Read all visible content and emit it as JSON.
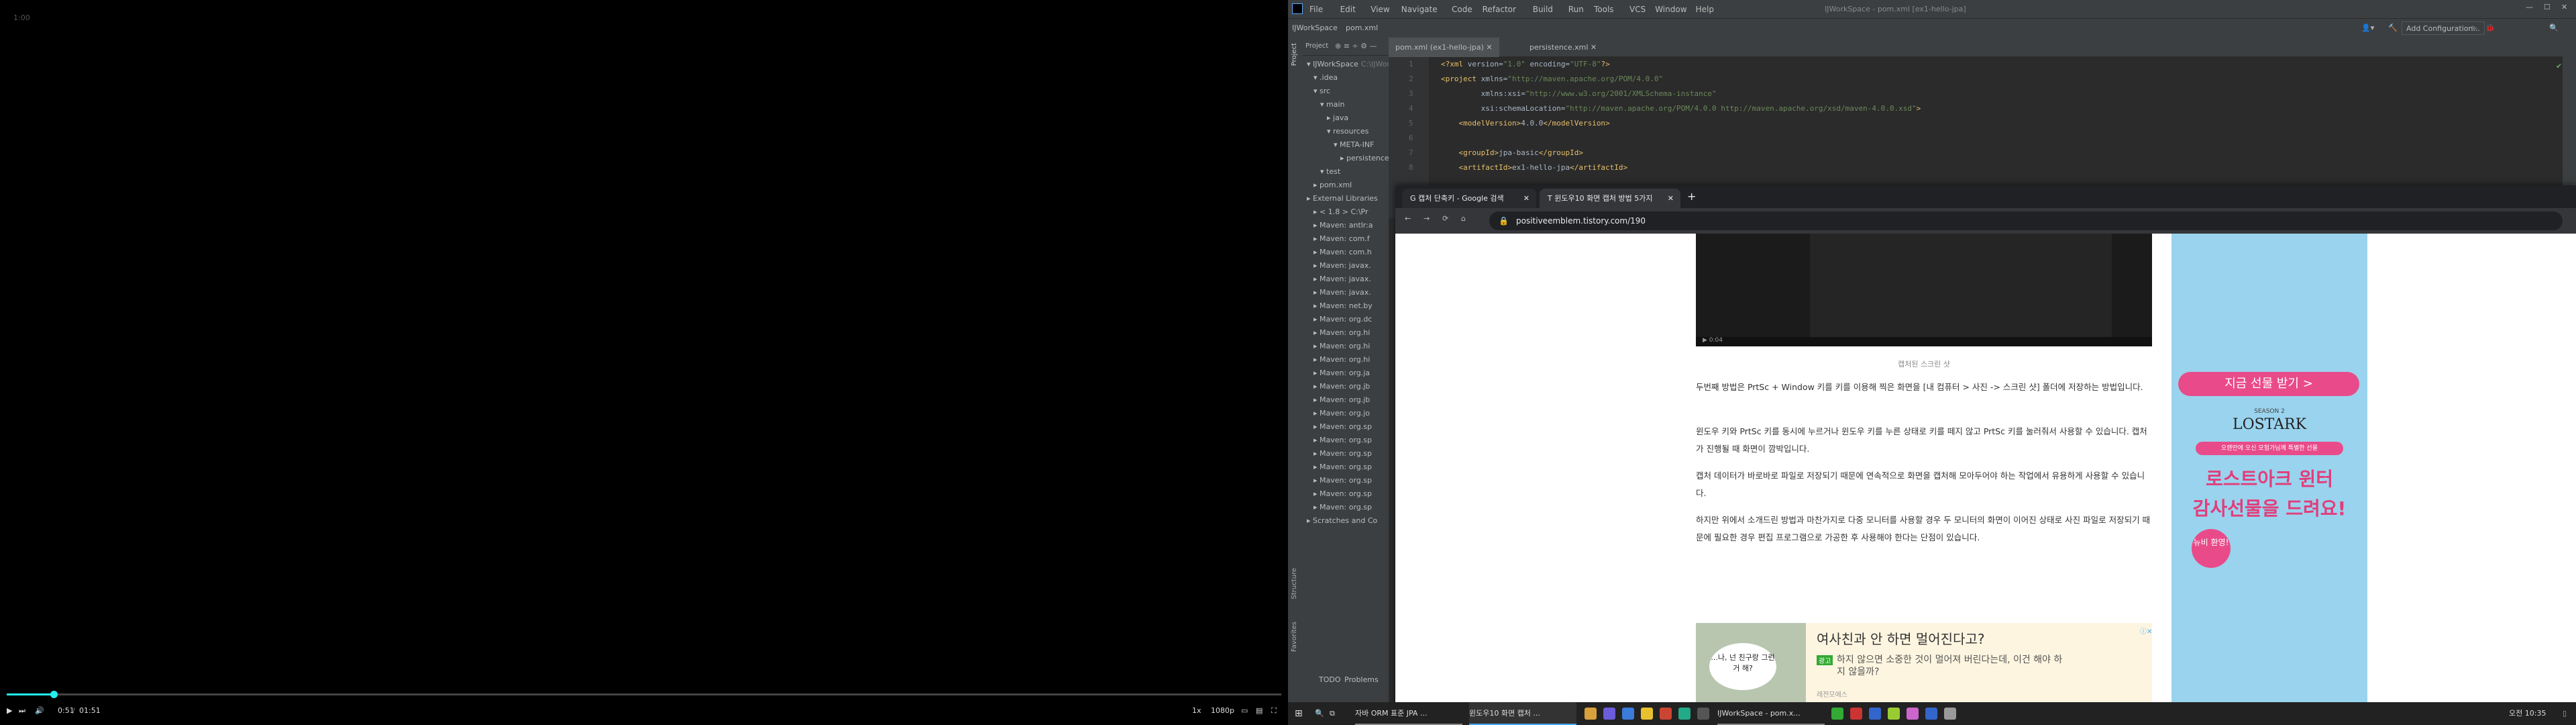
{
  "video": {
    "corner_time": "1:00",
    "controls": {
      "current": "0:51",
      "separator": "/",
      "duration": "01:51",
      "speed": "1x",
      "quality": "1080p"
    },
    "progress": 0.037
  },
  "ide": {
    "menu": [
      "File",
      "Edit",
      "View",
      "Navigate",
      "Code",
      "Refactor",
      "Build",
      "Run",
      "Tools",
      "VCS",
      "Window",
      "Help"
    ],
    "window_title": "IJWorkSpace - pom.xml [ex1-hello-jpa]",
    "breadcrumb": [
      "IJWorkSpace",
      "pom.xml"
    ],
    "add_config": "Add Configuration...",
    "project_label": "Project",
    "tree": [
      {
        "label": "IJWorkSpace",
        "suffix": "C:\\IJWorkSp",
        "indent": 0
      },
      {
        "label": ".idea",
        "indent": 1
      },
      {
        "label": "src",
        "indent": 1
      },
      {
        "label": "main",
        "indent": 2
      },
      {
        "label": "java",
        "indent": 3
      },
      {
        "label": "resources",
        "indent": 3
      },
      {
        "label": "META-INF",
        "indent": 4
      },
      {
        "label": "persistence.x",
        "indent": 5
      },
      {
        "label": "test",
        "indent": 2
      },
      {
        "label": "pom.xml",
        "indent": 1
      },
      {
        "label": "External Libraries",
        "indent": 0
      },
      {
        "label": "< 1.8 > C:\\Pr",
        "indent": 1
      },
      {
        "label": "Maven: antlr:a",
        "indent": 1
      },
      {
        "label": "Maven: com.f",
        "indent": 1
      },
      {
        "label": "Maven: com.h",
        "indent": 1
      },
      {
        "label": "Maven: javax.",
        "indent": 1
      },
      {
        "label": "Maven: javax.",
        "indent": 1
      },
      {
        "label": "Maven: javax.",
        "indent": 1
      },
      {
        "label": "Maven: net.by",
        "indent": 1
      },
      {
        "label": "Maven: org.dc",
        "indent": 1
      },
      {
        "label": "Maven: org.hi",
        "indent": 1
      },
      {
        "label": "Maven: org.hi",
        "indent": 1
      },
      {
        "label": "Maven: org.hi",
        "indent": 1
      },
      {
        "label": "Maven: org.ja",
        "indent": 1
      },
      {
        "label": "Maven: org.jb",
        "indent": 1
      },
      {
        "label": "Maven: org.jb",
        "indent": 1
      },
      {
        "label": "Maven: org.jo",
        "indent": 1
      },
      {
        "label": "Maven: org.sp",
        "indent": 1
      },
      {
        "label": "Maven: org.sp",
        "indent": 1
      },
      {
        "label": "Maven: org.sp",
        "indent": 1
      },
      {
        "label": "Maven: org.sp",
        "indent": 1
      },
      {
        "label": "Maven: org.sp",
        "indent": 1
      },
      {
        "label": "Maven: org.sp",
        "indent": 1
      },
      {
        "label": "Maven: org.sp",
        "indent": 1
      },
      {
        "label": "Scratches and Co",
        "indent": 0
      }
    ],
    "tabs": [
      "pom.xml (ex1-hello-jpa)",
      "persistence.xml"
    ],
    "code_lines": [
      {
        "n": "1",
        "t": "<?xml version=\"1.0\" encoding=\"UTF-8\"?>"
      },
      {
        "n": "2",
        "t": "<project xmlns=\"http://maven.apache.org/POM/4.0.0\""
      },
      {
        "n": "3",
        "t": "         xmlns:xsi=\"http://www.w3.org/2001/XMLSchema-instance\""
      },
      {
        "n": "4",
        "t": "         xsi:schemaLocation=\"http://maven.apache.org/POM/4.0.0 http://maven.apache.org/xsd/maven-4.0.0.xsd\">"
      },
      {
        "n": "5",
        "t": "    <modelVersion>4.0.0</modelVersion>"
      },
      {
        "n": "6",
        "t": ""
      },
      {
        "n": "7",
        "t": "    <groupId>jpa-basic</groupId>"
      },
      {
        "n": "8",
        "t": "    <artifactId>ex1-hello-jpa</artifactId>"
      }
    ],
    "bottom_tabs": [
      "TODO",
      "Problems"
    ],
    "left_side_tools": [
      "Structure",
      "Favorites"
    ]
  },
  "chrome": {
    "tabs": [
      "캡처 단축키 - Google 검색",
      "윈도우10 화면 캡처 방법 5가지"
    ],
    "url": "positiveemblem.tistory.com/190",
    "caption": "캡처된 스크린 샷",
    "paragraphs": [
      "두번째 방법은 PrtSc + Window 키를 키를 이용해 찍은 화면을 [내 컴퓨터 > 사진 -> 스크린 샷] 폴더에 저장하는 방법입니다.",
      "윈도우 키와 PrtSc 키를 동시에 누르거나 윈도우 키를 누른 상태로 키를 떼지 않고 PrtSc 키를 눌러줘서 사용할 수 있습니다. 캡처가 진행될 때 화면이 깜박입니다.",
      "캡처 데이터가 바로바로 파일로 저장되기 때문에 연속적으로 화면을 캡처해 모아두어야 하는 작업에서 유용하게 사용할 수 있습니다.",
      "하지만 위에서 소개드린 방법과 마찬가지로 다중 모니터를 사용할 경우 두 모니터의 화면이 이어진 상태로 사진 파일로 저장되기 때문에 필요한 경우 편집 프로그램으로 가공한 후 사용해야 한다는 단점이 있습니다."
    ],
    "ad": {
      "bubble": "...나, 넌 친구랑 그런거 해?",
      "headline": "여사친과 안 하면 멀어진다고?",
      "badge": "광고",
      "body": "하지 않으면 소중한 것이 멀어져 버린다는데, 이건 해야 하지 않을까?",
      "source": "레전모에스"
    },
    "side_ad": {
      "btn": "지금 선물 받기 >",
      "brand": "LOSTARK",
      "season": "SEASON 2",
      "banner": "오랜만에 오신 모험가님께 특별한 선물",
      "title1": "로스트아크 윈터",
      "title2": "감사선물을 드려요!",
      "badge": "뉴비 환영!"
    }
  },
  "taskbar": {
    "items": [
      "자바 ORM 표준 JPA ...",
      "윈도우10 화면 캡처 ...",
      "IJWorkSpace - pom.x..."
    ],
    "time": "오전 10:35"
  }
}
